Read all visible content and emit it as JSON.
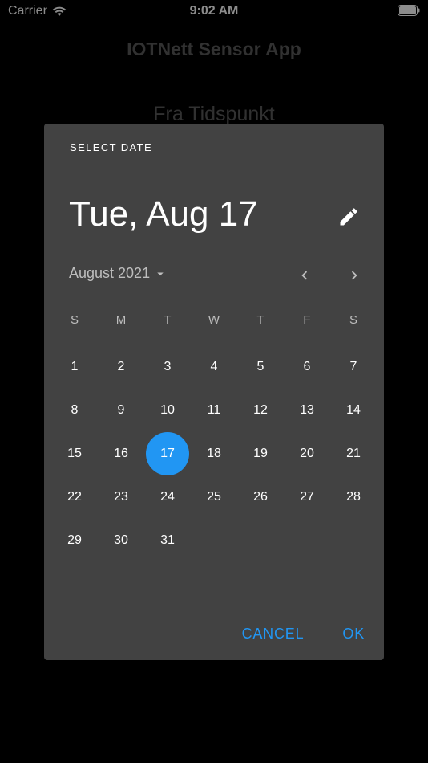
{
  "status_bar": {
    "carrier": "Carrier",
    "time": "9:02 AM"
  },
  "app": {
    "title": "IOTNett Sensor App",
    "behind_label": "Fra Tidspunkt"
  },
  "date_picker": {
    "header_label": "SELECT DATE",
    "selected_date": "Tue, Aug 17",
    "month_year": "August 2021",
    "weekdays": [
      "S",
      "M",
      "T",
      "W",
      "T",
      "F",
      "S"
    ],
    "first_day_offset": 0,
    "days": [
      "1",
      "2",
      "3",
      "4",
      "5",
      "6",
      "7",
      "8",
      "9",
      "10",
      "11",
      "12",
      "13",
      "14",
      "15",
      "16",
      "17",
      "18",
      "19",
      "20",
      "21",
      "22",
      "23",
      "24",
      "25",
      "26",
      "27",
      "28",
      "29",
      "30",
      "31"
    ],
    "selected_day": "17",
    "cancel_label": "CANCEL",
    "ok_label": "OK",
    "accent_color": "#2196f3",
    "dialog_color": "#424242"
  }
}
